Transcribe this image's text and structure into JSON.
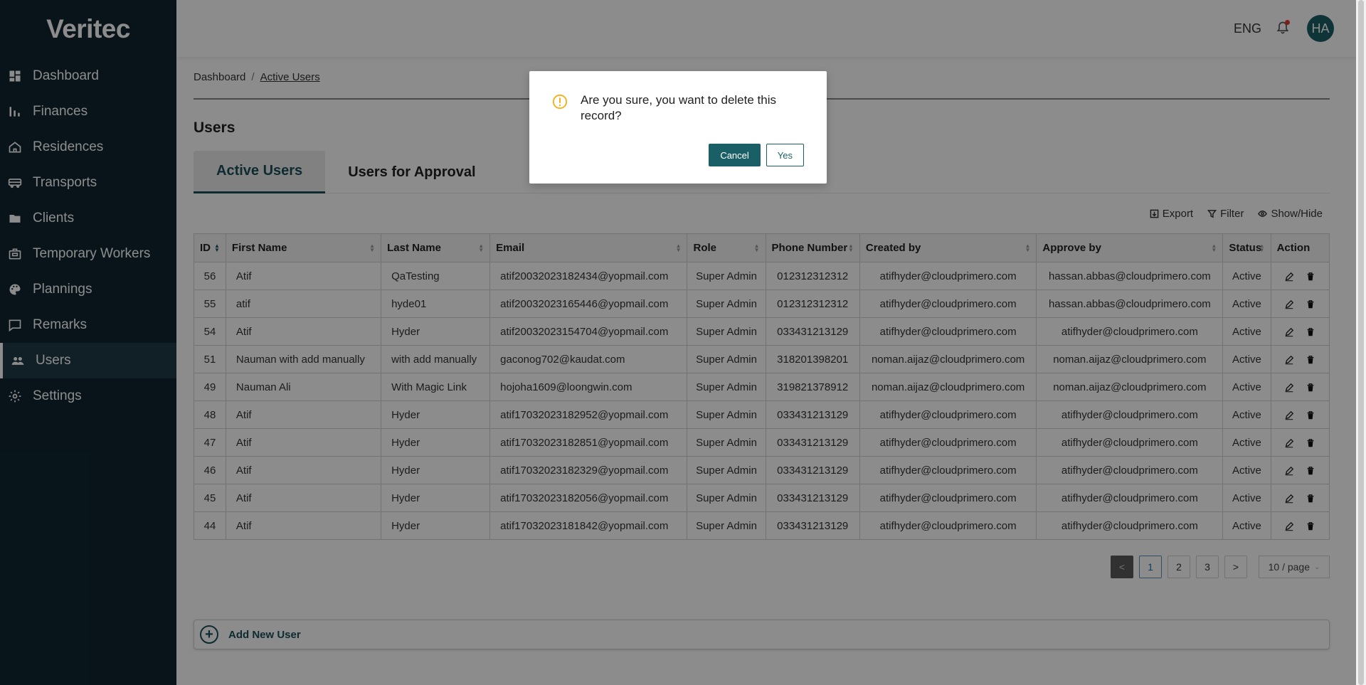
{
  "app": {
    "logo": "Veritec"
  },
  "sidebar": {
    "items": [
      {
        "label": "Dashboard",
        "icon": "dashboard-icon"
      },
      {
        "label": "Finances",
        "icon": "bar-chart-icon"
      },
      {
        "label": "Residences",
        "icon": "home-icon"
      },
      {
        "label": "Transports",
        "icon": "bus-icon"
      },
      {
        "label": "Clients",
        "icon": "folder-icon"
      },
      {
        "label": "Temporary Workers",
        "icon": "briefcase-icon"
      },
      {
        "label": "Plannings",
        "icon": "palette-icon"
      },
      {
        "label": "Remarks",
        "icon": "message-icon"
      },
      {
        "label": "Users",
        "icon": "users-icon",
        "active": true
      },
      {
        "label": "Settings",
        "icon": "gear-icon"
      }
    ]
  },
  "topbar": {
    "language": "ENG",
    "avatar_initials": "HA"
  },
  "breadcrumb": {
    "home": "Dashboard",
    "separator": "/",
    "current": "Active Users"
  },
  "page": {
    "title": "Users"
  },
  "tabs": [
    {
      "label": "Active Users",
      "active": true
    },
    {
      "label": "Users for Approval",
      "active": false
    }
  ],
  "toolbar": {
    "export": "Export",
    "filter": "Filter",
    "show_hide": "Show/Hide"
  },
  "table": {
    "headers": [
      "ID",
      "First Name",
      "Last Name",
      "Email",
      "Role",
      "Phone Number",
      "Created by",
      "Approve by",
      "Status",
      "Action"
    ],
    "rows": [
      [
        "56",
        "Atif",
        "QaTesting",
        "atif20032023182434@yopmail.com",
        "Super Admin",
        "012312312312",
        "atifhyder@cloudprimero.com",
        "hassan.abbas@cloudprimero.com",
        "Active"
      ],
      [
        "55",
        "atif",
        "hyde01",
        "atif20032023165446@yopmail.com",
        "Super Admin",
        "012312312312",
        "atifhyder@cloudprimero.com",
        "hassan.abbas@cloudprimero.com",
        "Active"
      ],
      [
        "54",
        "Atif",
        "Hyder",
        "atif20032023154704@yopmail.com",
        "Super Admin",
        "033431213129",
        "atifhyder@cloudprimero.com",
        "atifhyder@cloudprimero.com",
        "Active"
      ],
      [
        "51",
        "Nauman with add manually",
        "with add manually",
        "gaconog702@kaudat.com",
        "Super Admin",
        "318201398201",
        "noman.aijaz@cloudprimero.com",
        "noman.aijaz@cloudprimero.com",
        "Active"
      ],
      [
        "49",
        "Nauman Ali",
        "With Magic Link",
        "hojoha1609@loongwin.com",
        "Super Admin",
        "319821378912",
        "noman.aijaz@cloudprimero.com",
        "noman.aijaz@cloudprimero.com",
        "Active"
      ],
      [
        "48",
        "Atif",
        "Hyder",
        "atif17032023182952@yopmail.com",
        "Super Admin",
        "033431213129",
        "atifhyder@cloudprimero.com",
        "atifhyder@cloudprimero.com",
        "Active"
      ],
      [
        "47",
        "Atif",
        "Hyder",
        "atif17032023182851@yopmail.com",
        "Super Admin",
        "033431213129",
        "atifhyder@cloudprimero.com",
        "atifhyder@cloudprimero.com",
        "Active"
      ],
      [
        "46",
        "Atif",
        "Hyder",
        "atif17032023182329@yopmail.com",
        "Super Admin",
        "033431213129",
        "atifhyder@cloudprimero.com",
        "atifhyder@cloudprimero.com",
        "Active"
      ],
      [
        "45",
        "Atif",
        "Hyder",
        "atif17032023182056@yopmail.com",
        "Super Admin",
        "033431213129",
        "atifhyder@cloudprimero.com",
        "atifhyder@cloudprimero.com",
        "Active"
      ],
      [
        "44",
        "Atif",
        "Hyder",
        "atif17032023181842@yopmail.com",
        "Super Admin",
        "033431213129",
        "atifhyder@cloudprimero.com",
        "atifhyder@cloudprimero.com",
        "Active"
      ]
    ]
  },
  "pagination": {
    "prev": "<",
    "pages": [
      "1",
      "2",
      "3"
    ],
    "current": "1",
    "next": ">",
    "page_size": "10 / page"
  },
  "add_user": {
    "label": "Add New User"
  },
  "modal": {
    "message": "Are you sure, you want to delete this record?",
    "cancel": "Cancel",
    "yes": "Yes"
  },
  "colors": {
    "sidebar_bg": "#0f2631",
    "accent": "#1a5f65",
    "warning": "#faad14"
  }
}
